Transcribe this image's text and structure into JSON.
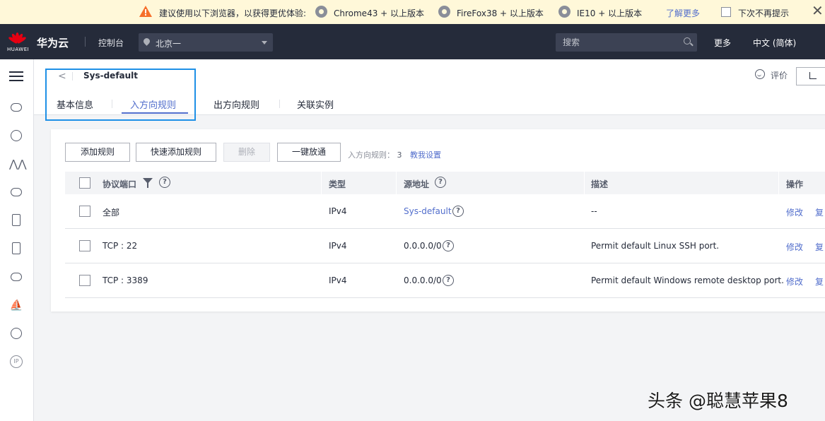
{
  "notice": {
    "message": "建议使用以下浏览器，以获得更优体验:",
    "browsers": [
      "Chrome43 + 以上版本",
      "FireFox38 + 以上版本",
      "IE10 + 以上版本"
    ],
    "learn_more": "了解更多",
    "dont_show": "下次不再提示",
    "close": "✕"
  },
  "header": {
    "logo_text": "HUAWEI",
    "brand": "华为云",
    "console": "控制台",
    "region": "北京一",
    "search_placeholder": "搜索",
    "more": "更多",
    "language": "中文 (简体)"
  },
  "page": {
    "back": "<",
    "title": "Sys-default",
    "tabs": [
      "基本信息",
      "入方向规则",
      "出方向规则",
      "关联实例"
    ],
    "active_tab": "入方向规则",
    "rate": "评价"
  },
  "toolbar": {
    "add_rule": "添加规则",
    "quick_add": "快速添加规则",
    "delete": "删除",
    "allow_all": "一键放通",
    "rule_count_label": "入方向规则：",
    "rule_count": "3",
    "setup_help": "教我设置"
  },
  "table": {
    "headers": [
      "协议端口",
      "类型",
      "源地址",
      "描述",
      "操作"
    ],
    "rows": [
      {
        "port": "全部",
        "type": "IPv4",
        "source": "Sys-default",
        "description": "--",
        "modify": "修改",
        "copy": "复"
      },
      {
        "port": "TCP : 22",
        "type": "IPv4",
        "source": "0.0.0.0/0",
        "description": "Permit default Linux SSH port.",
        "modify": "修改",
        "copy": "复"
      },
      {
        "port": "TCP : 3389",
        "type": "IPv4",
        "source": "0.0.0.0/0",
        "description": "Permit default Windows remote desktop port.",
        "modify": "修改",
        "copy": "复"
      }
    ]
  },
  "watermark": "头条 @聪慧苹果8",
  "colors": {
    "header_bg": "#252b3a",
    "link": "#526ecc",
    "highlight_box": "#1e90e6",
    "notice_bg": "#fff8d9",
    "huawei_red": "#e60012"
  }
}
